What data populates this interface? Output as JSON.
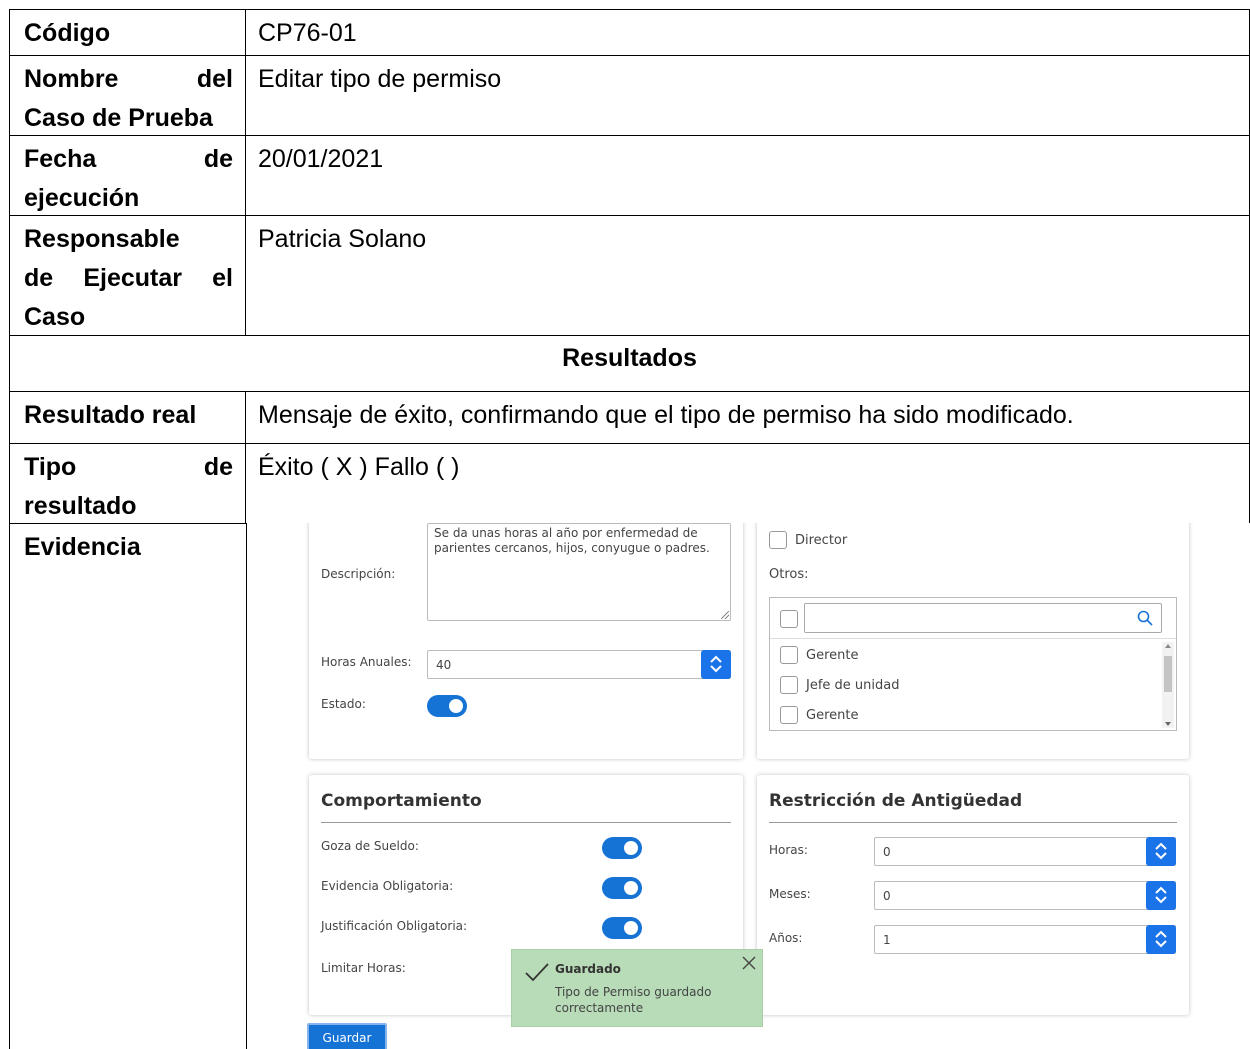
{
  "table": {
    "codigo": {
      "label": "Código",
      "value": "CP76-01"
    },
    "nombre": {
      "label_l1": "Nombre del",
      "label_l2": "Caso de Prueba",
      "value": "Editar tipo de permiso"
    },
    "fecha": {
      "label_l1": "Fecha de",
      "label_l2": "ejecución",
      "value": "20/01/2021"
    },
    "responsable": {
      "label_l1": "Responsable",
      "label_l2": "de Ejecutar el",
      "label_l3": "Caso",
      "value": "Patricia Solano"
    },
    "resultados_header": "Resultados",
    "resultado_real": {
      "label": "Resultado real",
      "value": "Mensaje de éxito, confirmando que el tipo de permiso ha sido modificado."
    },
    "tipo_resultado": {
      "label_l1": "Tipo de",
      "label_l2": "resultado",
      "value": "Éxito ( X ) Fallo ( )"
    },
    "evidencia": {
      "label": "Evidencia"
    }
  },
  "screenshot": {
    "general": {
      "descripcion_label": "Descripción:",
      "descripcion_value": "Se da unas horas al año por enfermedad de parientes cercanos, hijos, conyugue o padres.",
      "horas_anuales_label": "Horas Anuales:",
      "horas_anuales_value": "40",
      "estado_label": "Estado:"
    },
    "cargos": {
      "director_label": "Director",
      "otros_label": "Otros:",
      "search_placeholder": "",
      "items": [
        "Gerente",
        "Jefe de unidad",
        "Gerente"
      ]
    },
    "comportamiento": {
      "title": "Comportamiento",
      "goza_sueldo": "Goza de Sueldo:",
      "evidencia_obligatoria": "Evidencia Obligatoria:",
      "justificacion_obligatoria": "Justificación Obligatoria:",
      "limitar_horas": "Limitar Horas:"
    },
    "restriccion": {
      "title": "Restricción de Antigüedad",
      "horas_label": "Horas:",
      "horas_value": "0",
      "meses_label": "Meses:",
      "meses_value": "0",
      "anios_label": "Años:",
      "anios_value": "1"
    },
    "toast": {
      "title": "Guardado",
      "message": "Tipo de Permiso guardado correctamente"
    },
    "guardar_button": "Guardar"
  },
  "colors": {
    "accent": "#1673d6",
    "toast_bg": "#b8dbb8"
  }
}
